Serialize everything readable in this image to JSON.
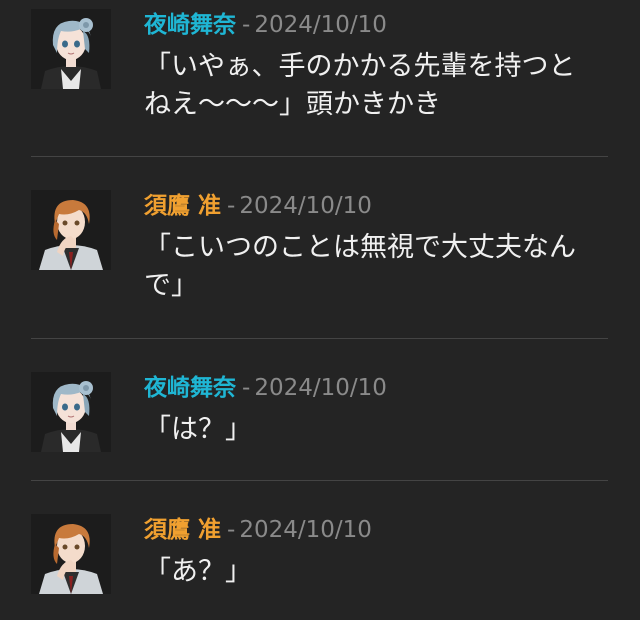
{
  "colors": {
    "background": "#242424",
    "name_maina": "#1fb6d4",
    "name_jun": "#f0a030",
    "meta": "#8a8a8a",
    "text": "#f0f0f0"
  },
  "messages": [
    {
      "author": "夜崎舞奈",
      "avatar": "silver-haired-girl-avatar",
      "separator": "-",
      "date": "2024/10/10",
      "lines": [
        "「いやぁ、手のかかる先輩を持つと",
        "ねえ～～～」頭かきかき"
      ]
    },
    {
      "author": "須鷹 准",
      "avatar": "orange-haired-boy-avatar",
      "separator": "-",
      "date": "2024/10/10",
      "lines": [
        "「こいつのことは無視で大丈夫なん",
        "で」"
      ]
    },
    {
      "author": "夜崎舞奈",
      "avatar": "silver-haired-girl-avatar",
      "separator": "-",
      "date": "2024/10/10",
      "lines": [
        "「は？」"
      ]
    },
    {
      "author": "須鷹 准",
      "avatar": "orange-haired-boy-avatar",
      "separator": "-",
      "date": "2024/10/10",
      "lines": [
        "「あ？」"
      ]
    }
  ]
}
